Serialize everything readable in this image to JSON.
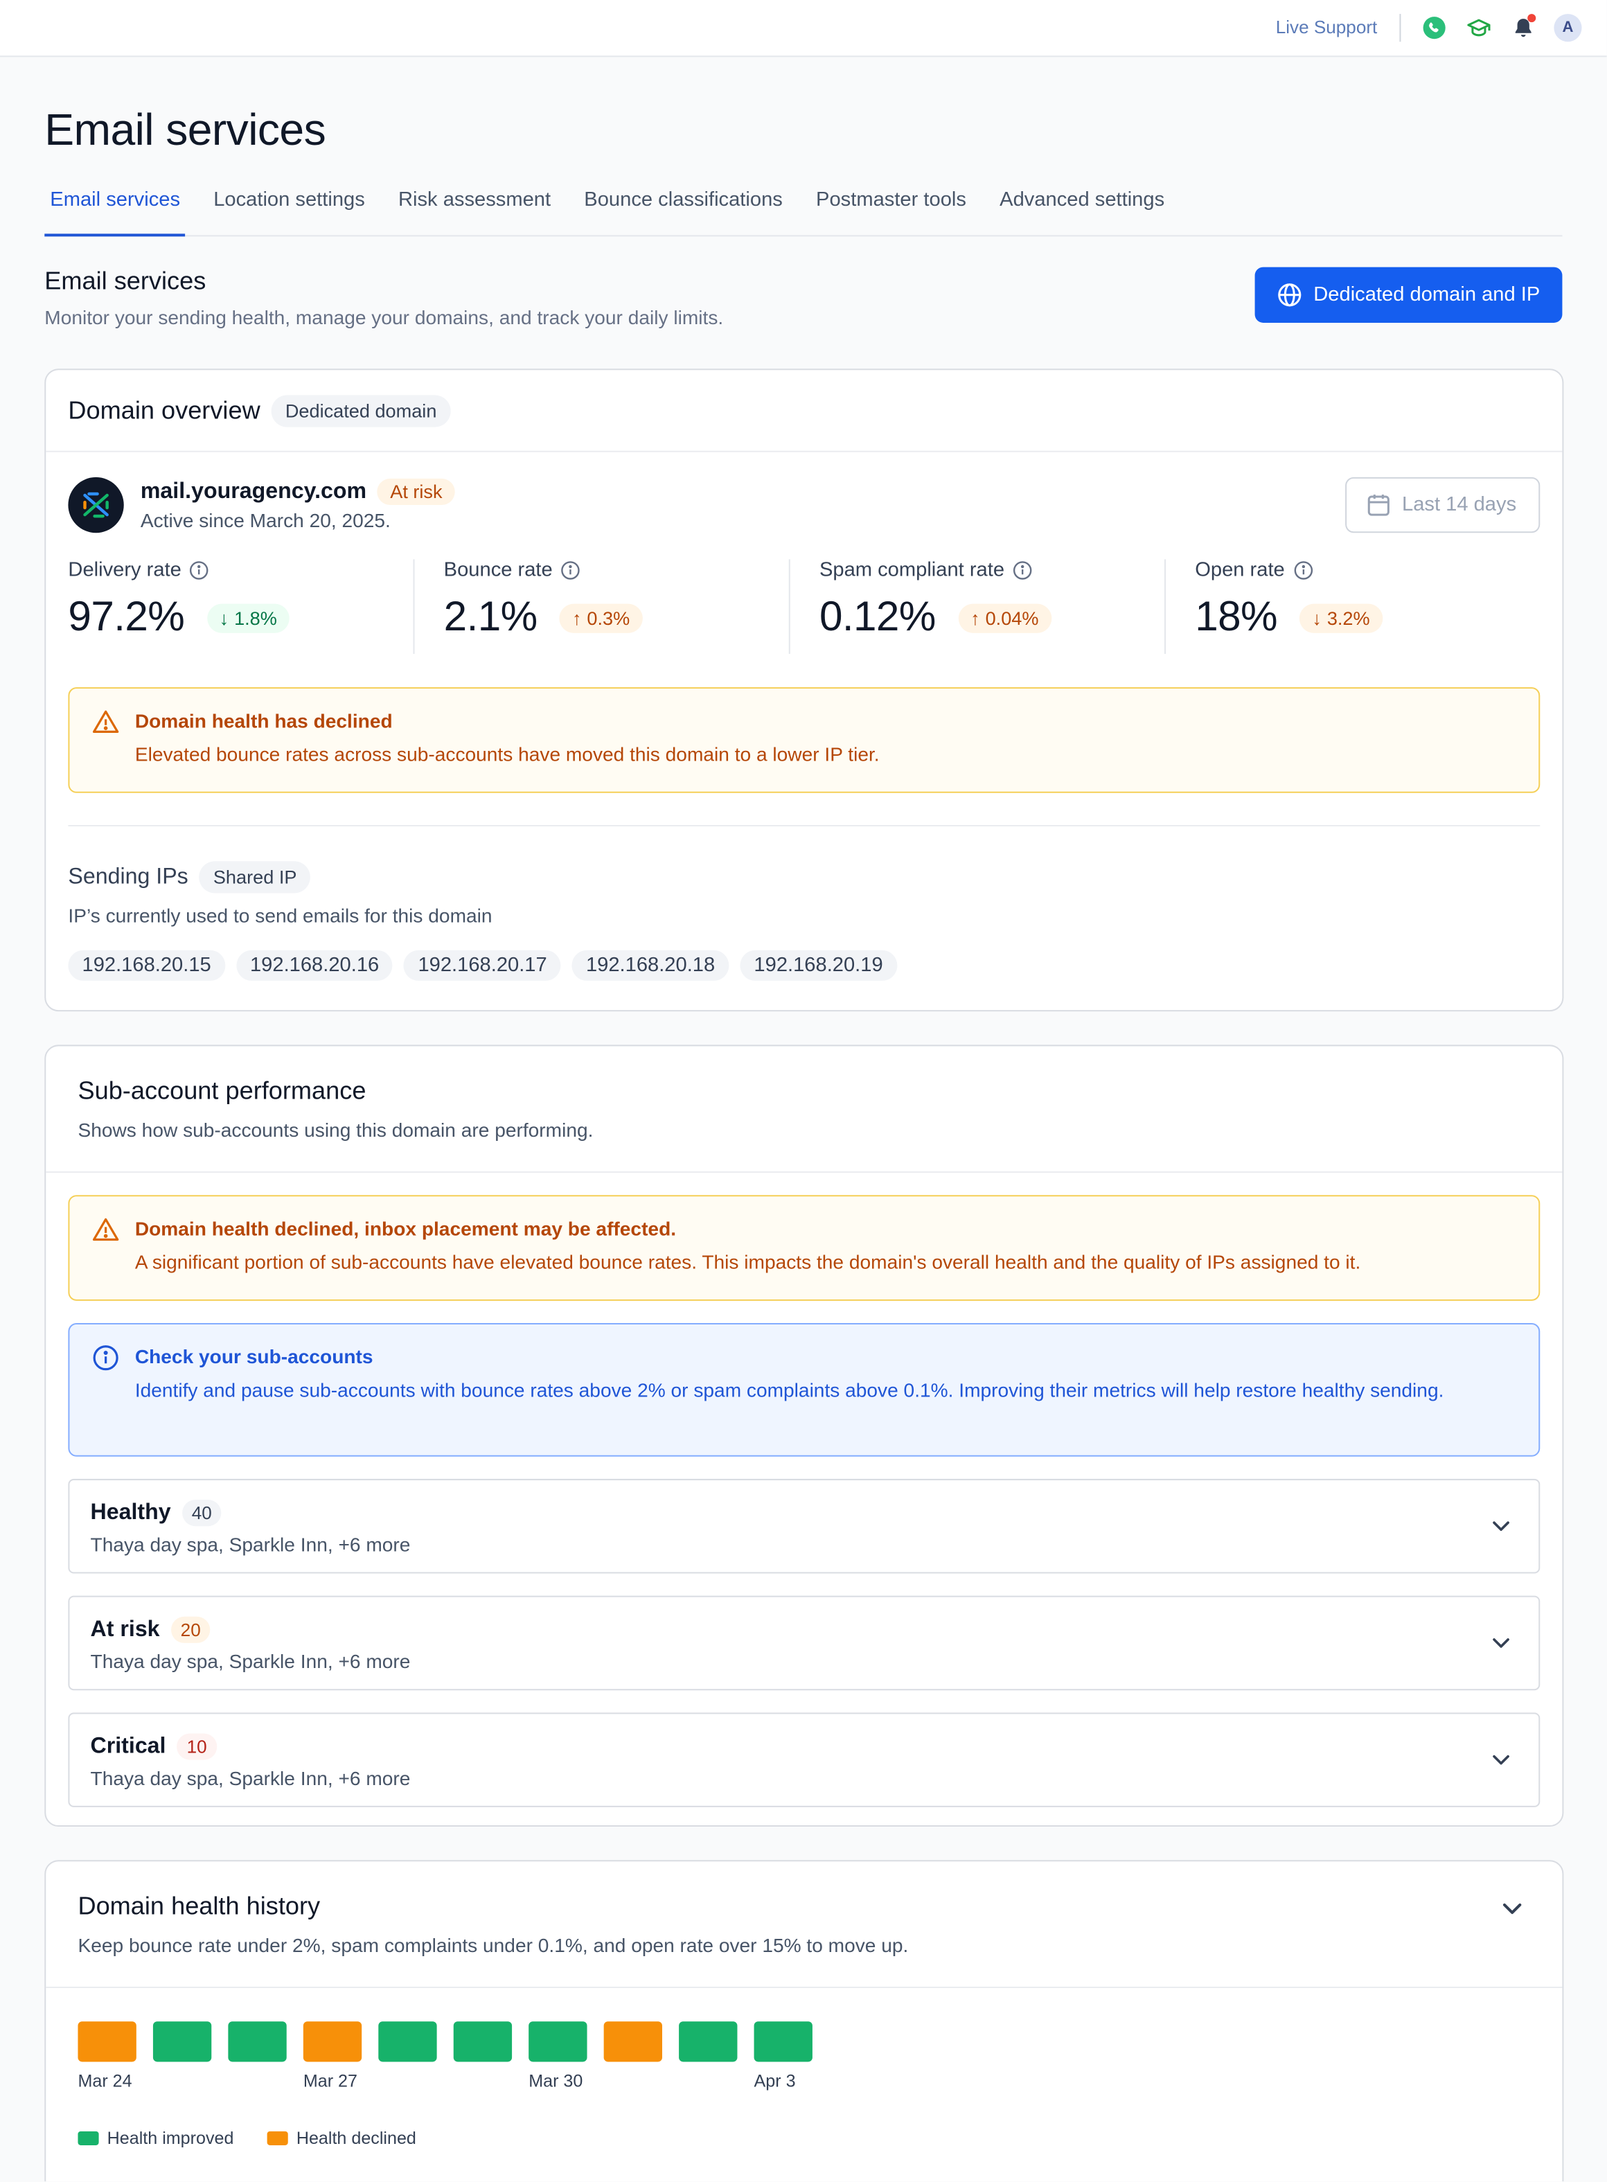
{
  "topbar": {
    "live_support": "Live Support",
    "avatar_initial": "A"
  },
  "page": {
    "title": "Email services",
    "tabs": [
      "Email services",
      "Location settings",
      "Risk assessment",
      "Bounce classifications",
      "Postmaster tools",
      "Advanced settings"
    ],
    "active_tab": "Email services"
  },
  "section": {
    "title": "Email services",
    "subtitle": "Monitor your sending health, manage your domains, and track your daily limits.",
    "primary_button": "Dedicated domain and IP"
  },
  "domain_overview": {
    "title": "Domain overview",
    "type_chip": "Dedicated domain",
    "domain_name": "mail.youragency.com",
    "status": "At risk",
    "active_since": "Active since March 20, 2025.",
    "date_range": "Last 14 days",
    "metrics": [
      {
        "label": "Delivery rate",
        "value": "97.2%",
        "delta": "1.8%",
        "direction": "down",
        "tone": "good"
      },
      {
        "label": "Bounce rate",
        "value": "2.1%",
        "delta": "0.3%",
        "direction": "up",
        "tone": "bad"
      },
      {
        "label": "Spam compliant rate",
        "value": "0.12%",
        "delta": "0.04%",
        "direction": "up",
        "tone": "bad"
      },
      {
        "label": "Open rate",
        "value": "18%",
        "delta": "3.2%",
        "direction": "down",
        "tone": "bad"
      }
    ],
    "alert": {
      "title": "Domain health has declined",
      "text": "Elevated bounce rates across sub-accounts have moved this domain to a lower IP tier."
    },
    "sending_ips": {
      "title": "Sending IPs",
      "chip": "Shared IP",
      "subtitle": "IP’s currently used to send emails for this domain",
      "ips": [
        "192.168.20.15",
        "192.168.20.16",
        "192.168.20.17",
        "192.168.20.18",
        "192.168.20.19"
      ]
    }
  },
  "subaccounts": {
    "title": "Sub-account performance",
    "subtitle": "Shows how sub-accounts using this domain are performing.",
    "warning": {
      "title": "Domain health declined, inbox placement may be affected.",
      "text": "A significant portion of sub-accounts have elevated bounce rates. This impacts the domain's overall health and the quality of IPs assigned to it."
    },
    "info": {
      "title": "Check your sub-accounts",
      "text": "Identify and pause sub-accounts with bounce rates above 2% or spam complaints above 0.1%. Improving their metrics will help restore healthy sending."
    },
    "groups": [
      {
        "title": "Healthy",
        "count": "40",
        "tone": "neutral",
        "members": "Thaya day spa, Sparkle Inn, +6 more"
      },
      {
        "title": "At risk",
        "count": "20",
        "tone": "warn",
        "members": "Thaya day spa, Sparkle Inn, +6 more"
      },
      {
        "title": "Critical",
        "count": "10",
        "tone": "crit",
        "members": "Thaya day spa, Sparkle Inn, +6 more"
      }
    ]
  },
  "history": {
    "title": "Domain health history",
    "subtitle": "Keep bounce rate under 2%, spam complaints under 0.1%, and open rate over 15% to move up.",
    "days": [
      {
        "label": "Mar 24",
        "status": "declined"
      },
      {
        "label": "",
        "status": "improved"
      },
      {
        "label": "",
        "status": "improved"
      },
      {
        "label": "Mar 27",
        "status": "declined"
      },
      {
        "label": "",
        "status": "improved"
      },
      {
        "label": "",
        "status": "improved"
      },
      {
        "label": "Mar 30",
        "status": "improved"
      },
      {
        "label": "",
        "status": "declined"
      },
      {
        "label": "",
        "status": "improved"
      },
      {
        "label": "Apr 3",
        "status": "improved"
      }
    ],
    "legend": {
      "improved": "Health improved",
      "declined": "Health declined"
    },
    "colors": {
      "improved": "#17b26a",
      "declined": "#f79009"
    }
  }
}
